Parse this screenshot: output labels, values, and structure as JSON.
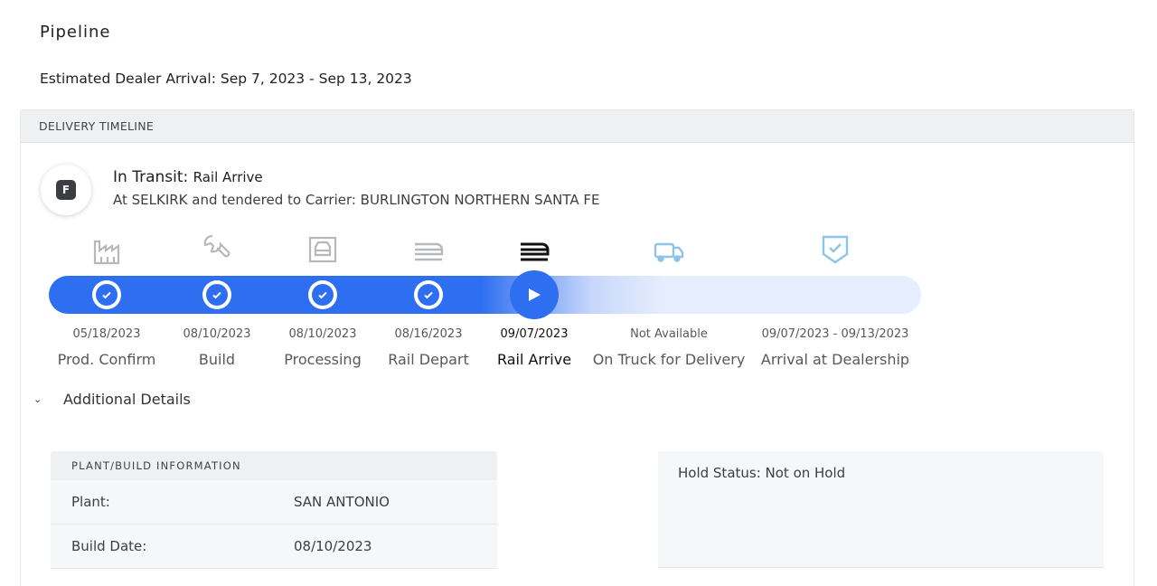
{
  "page": {
    "title": "Pipeline",
    "estimated_arrival": "Estimated Dealer Arrival: Sep 7, 2023 - Sep 13, 2023"
  },
  "timeline": {
    "header": "DELIVERY TIMELINE",
    "status_icon_letter": "F",
    "status_label": "In Transit:",
    "status_value": "Rail Arrive",
    "status_detail": "At SELKIRK and tendered to Carrier: BURLINGTON NORTHERN SANTA FE",
    "accent_color": "#2e6ef0",
    "milestones": [
      {
        "date": "05/18/2023",
        "label": "Prod. Confirm",
        "icon": "factory-icon",
        "state": "complete"
      },
      {
        "date": "08/10/2023",
        "label": "Build",
        "icon": "wrench-icon",
        "state": "complete"
      },
      {
        "date": "08/10/2023",
        "label": "Processing",
        "icon": "car-wash-icon",
        "state": "complete"
      },
      {
        "date": "08/16/2023",
        "label": "Rail Depart",
        "icon": "train-icon",
        "state": "complete"
      },
      {
        "date": "09/07/2023",
        "label": "Rail Arrive",
        "icon": "train-icon",
        "state": "active"
      },
      {
        "date": "Not Available",
        "label": "On Truck for Delivery",
        "icon": "truck-icon",
        "state": "pending"
      },
      {
        "date": "09/07/2023 - 09/13/2023",
        "label": "Arrival at Dealership",
        "icon": "shield-check-icon",
        "state": "pending"
      }
    ]
  },
  "details": {
    "toggle_label": "Additional Details",
    "plant": {
      "header": "PLANT/BUILD INFORMATION",
      "rows": [
        {
          "key": "Plant:",
          "value": "SAN ANTONIO"
        },
        {
          "key": "Build Date:",
          "value": "08/10/2023"
        }
      ]
    },
    "hold_status": "Hold Status: Not on Hold"
  }
}
